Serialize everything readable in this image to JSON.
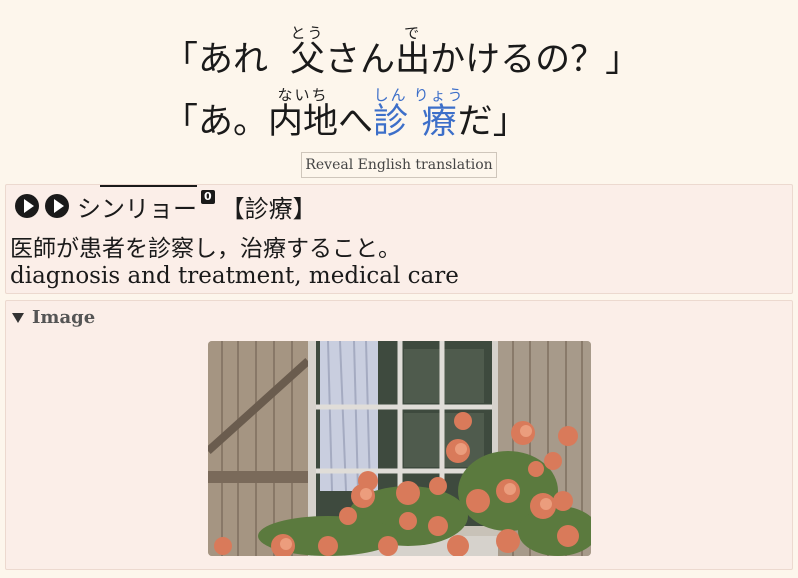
{
  "sentence1": {
    "open": "「",
    "w1": "あれ",
    "w2_base": "父",
    "w2_ruby": "とう",
    "w3": "さん",
    "w4_base": "出",
    "w4_ruby": "で",
    "w5": "かけるの？",
    "close": "」"
  },
  "sentence2": {
    "open": "「",
    "w1": "あ。",
    "w2_base": "内地",
    "w2_ruby": "ないち",
    "w3": "へ",
    "w4_base1": "診",
    "w4_base2": "療",
    "w4_ruby1": "しん",
    "w4_ruby2": "りょう",
    "w5": "だ",
    "close": "」"
  },
  "reveal_button": "Reveal English translation",
  "vocab": {
    "reading": "シンリョー",
    "pitch": "0",
    "kanji": "【診療】",
    "definition_jp": "医師が患者を診察し，治療すること。",
    "definition_en": "diagnosis and treatment, medical care"
  },
  "image_section": {
    "summary": "Image"
  }
}
